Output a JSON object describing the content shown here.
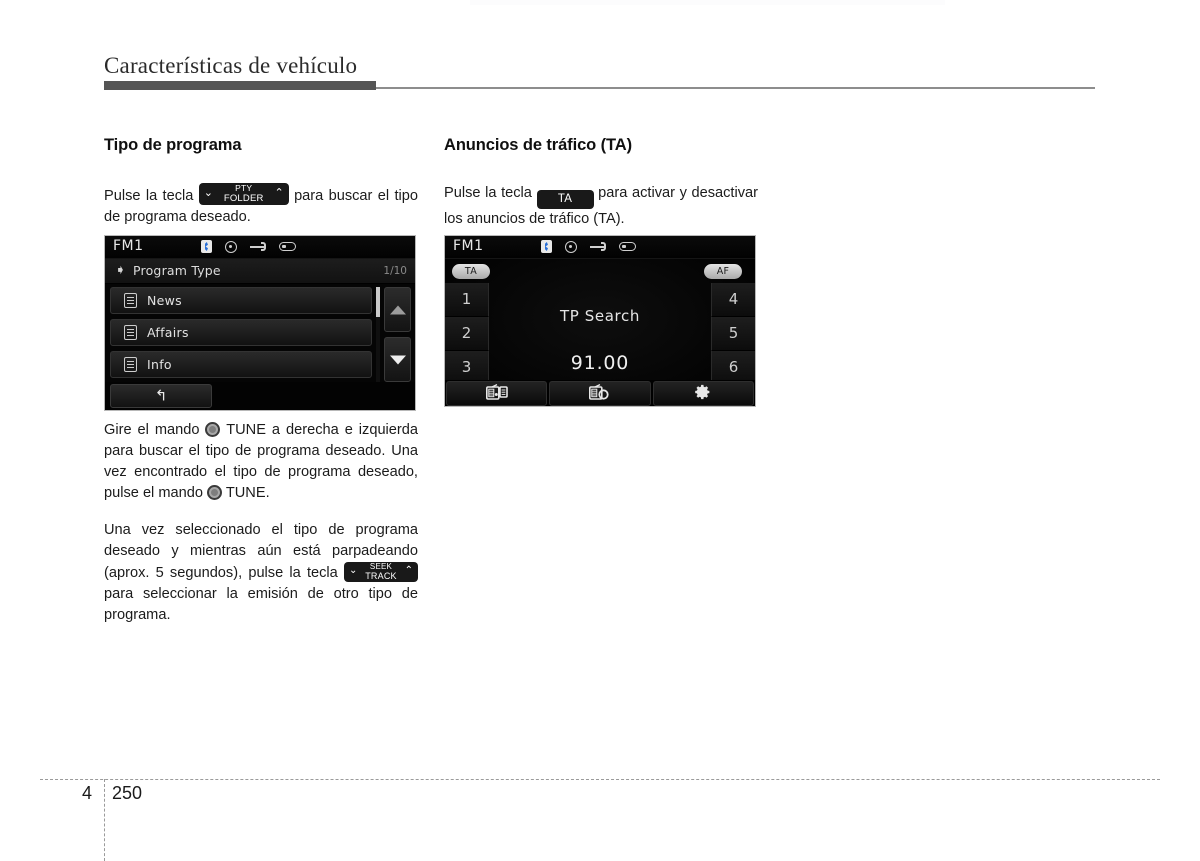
{
  "header": {
    "chapter_title": "Características de vehículo"
  },
  "left_column": {
    "heading": "Tipo de programa",
    "para1_before": "Pulse la tecla",
    "key_pty": {
      "line1": "PTY",
      "line2": "FOLDER",
      "chevron_left": "⌄",
      "chevron_right": "⌃"
    },
    "para1_after": "para buscar el tipo de programa deseado.",
    "para2_a": "Gire el mando",
    "para2_b": "TUNE a derecha e izquierda para buscar el tipo de programa deseado. Una vez encontrado el tipo de programa deseado, pulse el mando",
    "para2_c": "TUNE.",
    "para3_a": "Una vez seleccionado el tipo de programa deseado y mientras aún está parpadeando (aprox. 5 segundos), pulse la tecla",
    "key_seek": {
      "line1": "SEEK",
      "line2": "TRACK",
      "chevron_left": "⌄",
      "chevron_right": "⌃"
    },
    "para3_b": "para seleccionar la emisión de otro tipo de programa."
  },
  "right_column": {
    "heading": "Anuncios de tráfico (TA)",
    "para1_before": "Pulse la tecla",
    "key_ta": {
      "label": "TA"
    },
    "para1_after": "para activar y desactivar los anuncios de tráfico (TA)."
  },
  "device_pty": {
    "status": {
      "source": "FM1",
      "icons": [
        "bluetooth-icon",
        "disc-icon",
        "usb-icon",
        "device-icon"
      ]
    },
    "list_title": "Program Type",
    "pager": "1/10",
    "cursor_icon": "➧",
    "items": [
      {
        "label": "News",
        "icon": "list-document-icon"
      },
      {
        "label": "Affairs",
        "icon": "list-document-icon"
      },
      {
        "label": "Info",
        "icon": "list-document-icon"
      }
    ],
    "scroll_up_icon": "▲",
    "scroll_down_icon": "▼",
    "back_icon": "↰"
  },
  "device_ta": {
    "status": {
      "source": "FM1",
      "icons": [
        "bluetooth-icon",
        "disc-icon",
        "usb-icon",
        "device-icon"
      ]
    },
    "badge_ta": "TA",
    "badge_af": "AF",
    "presets_left": [
      "1",
      "2",
      "3"
    ],
    "presets_right": [
      "4",
      "5",
      "6"
    ],
    "status_text": "TP Search",
    "frequency": "91.00",
    "toolbar": [
      {
        "icon": "radio-list-icon"
      },
      {
        "icon": "radio-search-icon"
      },
      {
        "icon": "gear-icon"
      }
    ]
  },
  "footer": {
    "chapter_number": "4",
    "page_number": "250"
  },
  "colors": {
    "rule_thick": "#555555",
    "rule_thin": "#8d8d8d",
    "key_bg": "#191919",
    "screen_bg": "#000000",
    "bluetooth_blue": "#2a6fd6"
  }
}
